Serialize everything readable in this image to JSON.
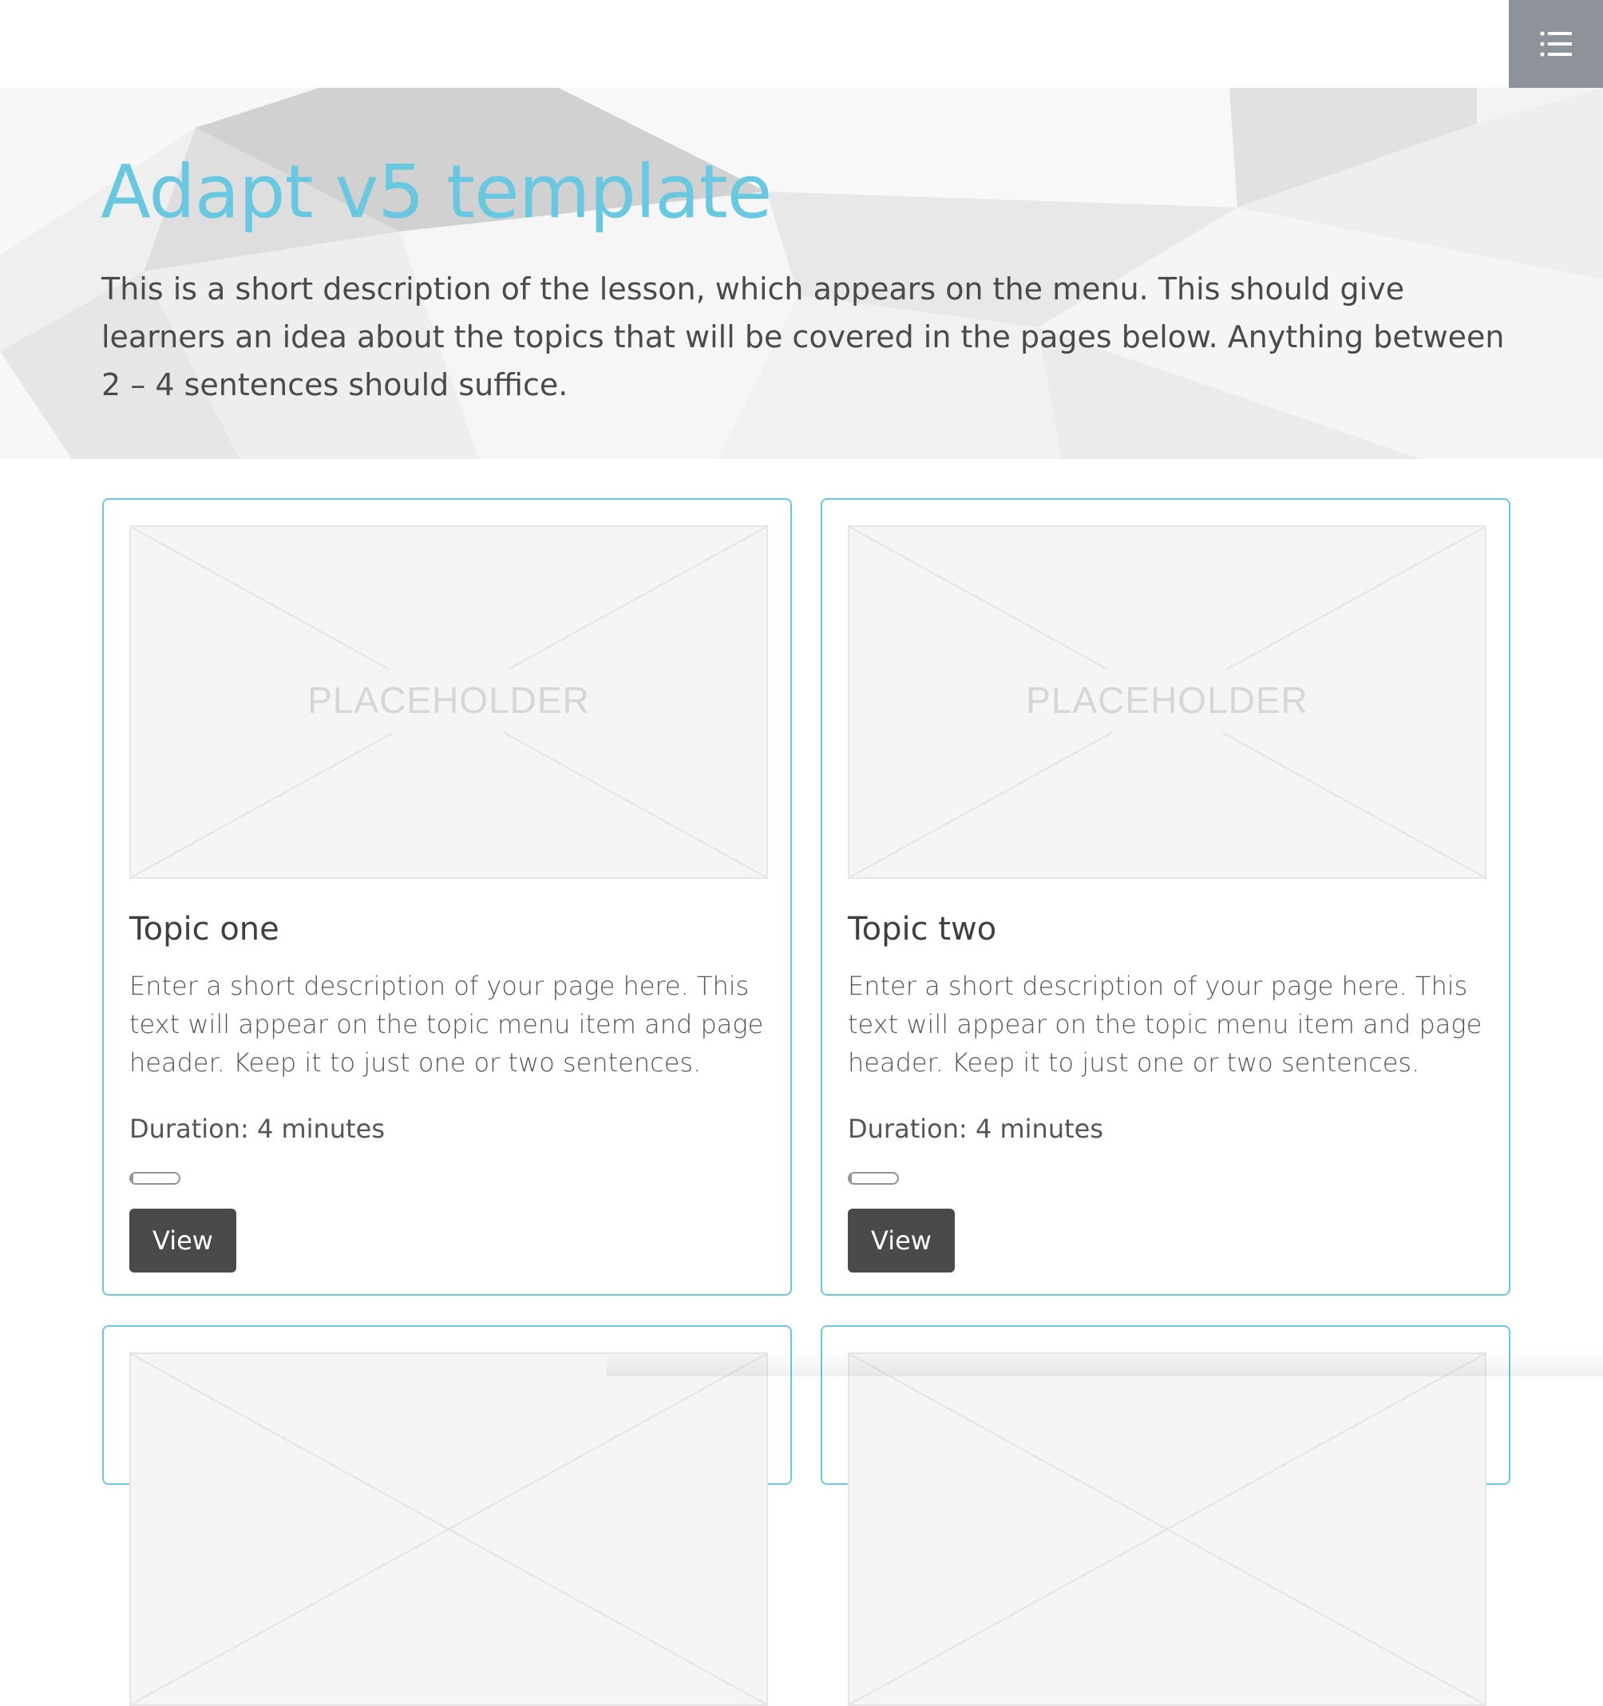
{
  "header": {
    "title": "Adapt v5 template",
    "description": "This is a short description of the lesson, which appears on the menu. This should give learners an idea about the topics that will be covered in the pages below. Anything between 2 – 4 sentences should suffice."
  },
  "navigation": {
    "menu_icon": "list-icon"
  },
  "colors": {
    "accent": "#67c8e0",
    "card_border": "#6cc8e0",
    "nav_button": "#8e939a",
    "view_button": "#4a4a4a"
  },
  "cards": [
    {
      "image_label": "PLACEHOLDER",
      "title": "Topic one",
      "description": "Enter a short description of your page here. This text will appear on the topic menu item and page header. Keep it to just one or two sentences.",
      "duration": "Duration: 4 minutes",
      "progress": 0.05,
      "button_label": "View"
    },
    {
      "image_label": "PLACEHOLDER",
      "title": "Topic two",
      "description": "Enter a short description of your page here. This text will appear on the topic menu item and page header. Keep it to just one or two sentences.",
      "duration": "Duration: 4 minutes",
      "progress": 0.05,
      "button_label": "View"
    }
  ]
}
